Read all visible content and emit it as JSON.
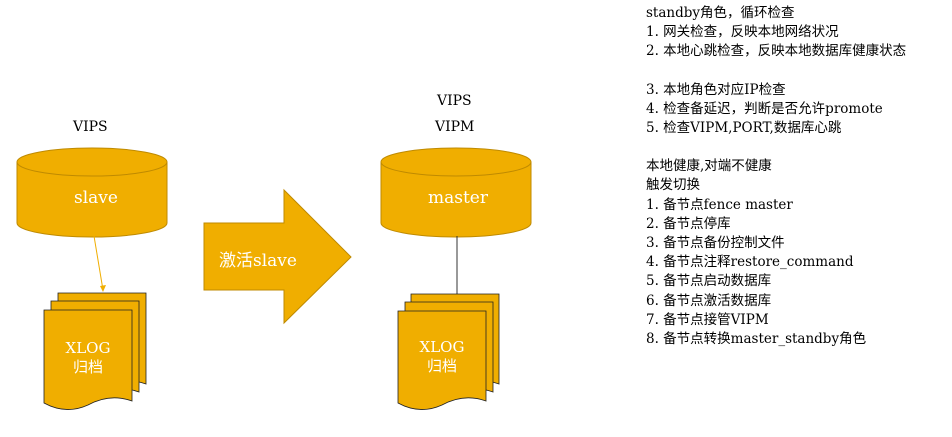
{
  "left": {
    "vips_label": "VIPS",
    "db_label": "slave",
    "archive_label_line1": "XLOG",
    "archive_label_line2": "归档"
  },
  "arrow": {
    "label": "激活slave"
  },
  "right": {
    "vips_label": "VIPS",
    "vipm_label": "VIPM",
    "db_label": "master",
    "archive_label_line1": "XLOG",
    "archive_label_line2": "归档"
  },
  "notes": {
    "role_title": "standby角色，循环检查",
    "checks_a": [
      "1. 网关检查，反映本地网络状况",
      "2. 本地心跳检查，反映本地数据库健康状态"
    ],
    "checks_b": [
      "3. 本地角色对应IP检查",
      "4. 检查备延迟，判断是否允许promote",
      "5. 检查VIPM,PORT,数据库心跳"
    ],
    "trigger_title_1": "本地健康,对端不健康",
    "trigger_title_2": "触发切换",
    "steps": [
      "1. 备节点fence master",
      "2. 备节点停库",
      "3. 备节点备份控制文件",
      "4. 备节点注释restore_command",
      "5. 备节点启动数据库",
      "6. 备节点激活数据库",
      "7. 备节点接管VIPM",
      "8. 备节点转换master_standby角色"
    ]
  },
  "colors": {
    "fill": "#F0AE00",
    "stroke": "#BF8A00",
    "connector": "#F0AE00"
  }
}
